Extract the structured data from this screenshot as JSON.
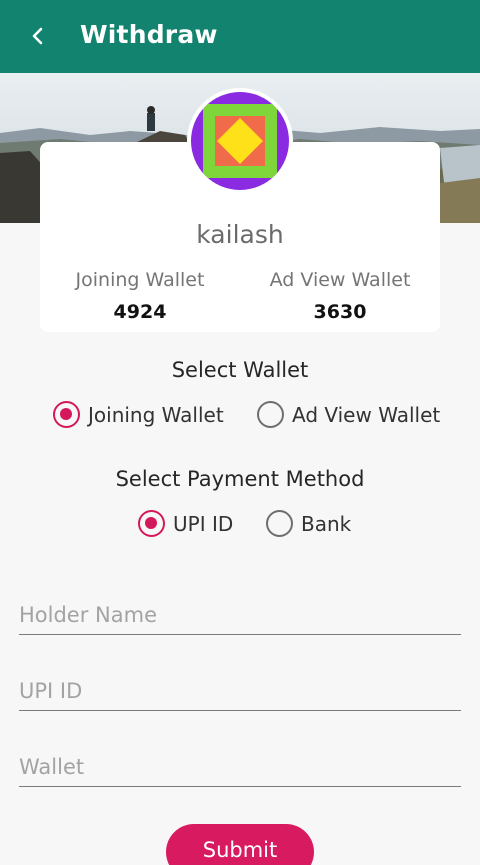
{
  "header": {
    "title": "Withdraw",
    "back_icon": "chevron-left-icon"
  },
  "colors": {
    "primary": "#12836f",
    "accent": "#d81b60",
    "radio_checked": "#d3195c"
  },
  "profile": {
    "username": "kailash",
    "avatar_icon": "colorful-square-diamond-logo",
    "wallets": [
      {
        "label": "Joining Wallet",
        "value": "4924"
      },
      {
        "label": "Ad View Wallet",
        "value": "3630"
      }
    ]
  },
  "select_wallet": {
    "title": "Select Wallet",
    "options": [
      {
        "label": "Joining Wallet",
        "checked": true
      },
      {
        "label": "Ad View Wallet",
        "checked": false
      }
    ]
  },
  "payment_method": {
    "title": "Select Payment Method",
    "options": [
      {
        "label": "UPI ID",
        "checked": true
      },
      {
        "label": "Bank",
        "checked": false
      }
    ]
  },
  "form": {
    "holder_name_placeholder": "Holder Name",
    "upi_id_placeholder": "UPI ID",
    "wallet_placeholder": "Wallet",
    "submit_label": "Submit"
  }
}
